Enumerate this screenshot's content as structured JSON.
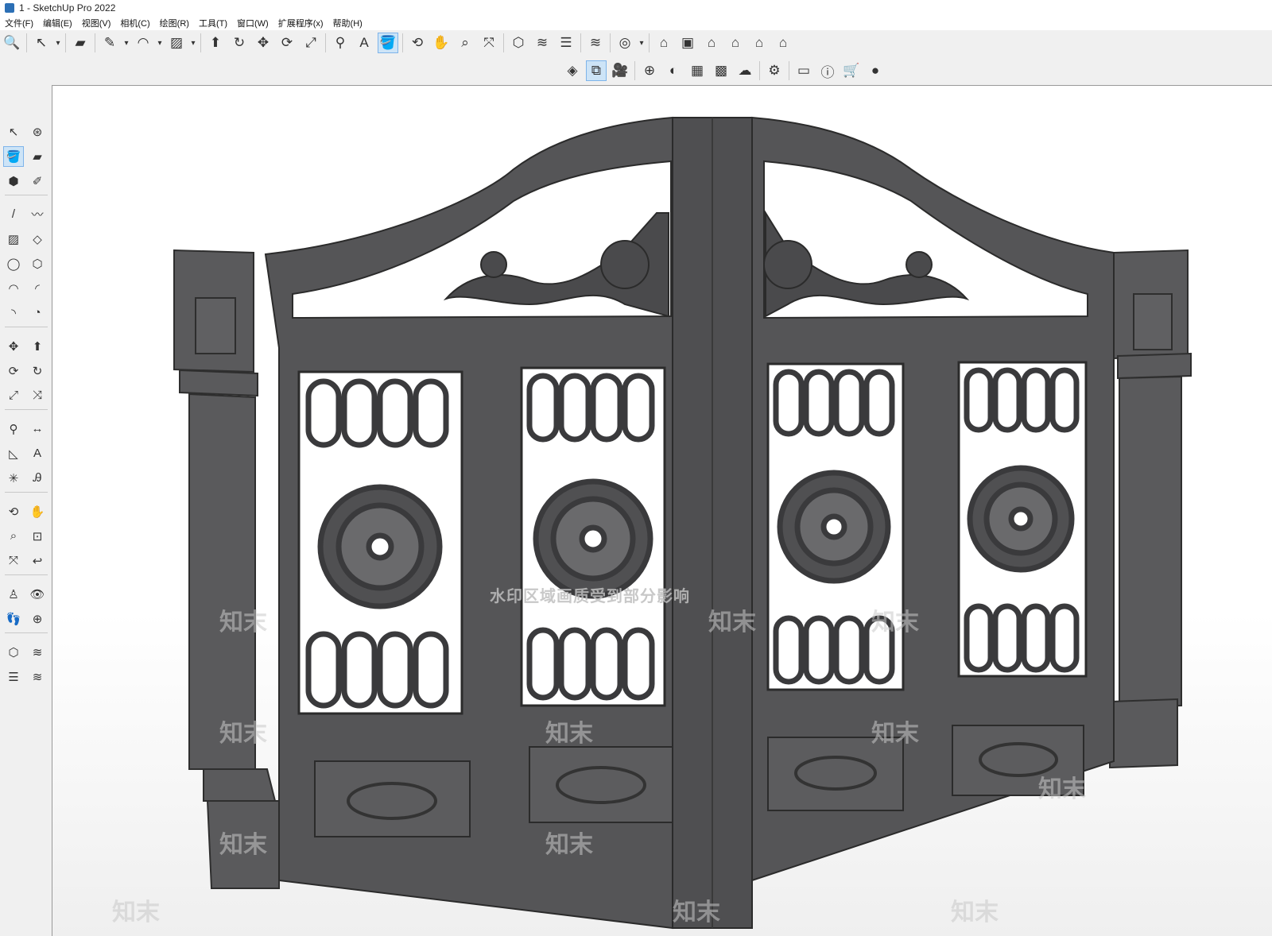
{
  "window": {
    "title": "1 - SketchUp Pro 2022"
  },
  "menu": [
    "文件(F)",
    "编辑(E)",
    "视图(V)",
    "相机(C)",
    "绘图(R)",
    "工具(T)",
    "窗口(W)",
    "扩展程序(x)",
    "帮助(H)"
  ],
  "toolbar_main": [
    {
      "name": "search-icon",
      "glyph": "🔍"
    },
    {
      "name": "sep"
    },
    {
      "name": "select-icon",
      "glyph": "↖"
    },
    {
      "name": "dropdown-icon",
      "glyph": "▾",
      "small": true
    },
    {
      "name": "sep"
    },
    {
      "name": "eraser-icon",
      "glyph": "▰"
    },
    {
      "name": "sep"
    },
    {
      "name": "pencil-icon",
      "glyph": "✎"
    },
    {
      "name": "dropdown-icon",
      "glyph": "▾",
      "small": true
    },
    {
      "name": "arc-icon",
      "glyph": "◠"
    },
    {
      "name": "dropdown-icon",
      "glyph": "▾",
      "small": true
    },
    {
      "name": "rectangle-icon",
      "glyph": "▨"
    },
    {
      "name": "dropdown-icon",
      "glyph": "▾",
      "small": true
    },
    {
      "name": "sep"
    },
    {
      "name": "push-pull-icon",
      "glyph": "⬆"
    },
    {
      "name": "follow-me-icon",
      "glyph": "↻"
    },
    {
      "name": "move-icon",
      "glyph": "✥"
    },
    {
      "name": "rotate-icon",
      "glyph": "⟳"
    },
    {
      "name": "scale-icon",
      "glyph": "⤢"
    },
    {
      "name": "sep"
    },
    {
      "name": "tape-measure-icon",
      "glyph": "⚲"
    },
    {
      "name": "text-icon",
      "glyph": "A"
    },
    {
      "name": "paint-bucket-icon",
      "glyph": "🪣",
      "active": true
    },
    {
      "name": "sep"
    },
    {
      "name": "orbit-icon",
      "glyph": "⟲"
    },
    {
      "name": "pan-icon",
      "glyph": "✋"
    },
    {
      "name": "zoom-icon",
      "glyph": "⌕"
    },
    {
      "name": "zoom-extents-icon",
      "glyph": "⤧"
    },
    {
      "name": "sep"
    },
    {
      "name": "warehouse-icon",
      "glyph": "⬡"
    },
    {
      "name": "extension-warehouse-icon",
      "glyph": "≋"
    },
    {
      "name": "layers-icon",
      "glyph": "☰"
    },
    {
      "name": "sep"
    },
    {
      "name": "extension-manager-icon",
      "glyph": "≋"
    },
    {
      "name": "sep"
    },
    {
      "name": "account-icon",
      "glyph": "◎"
    },
    {
      "name": "dropdown-icon",
      "glyph": "▾",
      "small": true
    },
    {
      "name": "sep"
    },
    {
      "name": "iso-view-icon",
      "glyph": "⌂"
    },
    {
      "name": "top-view-icon",
      "glyph": "▣"
    },
    {
      "name": "front-view-icon",
      "glyph": "⌂"
    },
    {
      "name": "right-view-icon",
      "glyph": "⌂"
    },
    {
      "name": "back-view-icon",
      "glyph": "⌂"
    },
    {
      "name": "left-view-icon",
      "glyph": "⌂"
    }
  ],
  "toolbar_secondary": [
    {
      "name": "solid-tools-icon",
      "glyph": "◈"
    },
    {
      "name": "section-plane-icon",
      "glyph": "⧉",
      "active": true
    },
    {
      "name": "camera-icon",
      "glyph": "🎥"
    },
    {
      "name": "sep"
    },
    {
      "name": "add-icon",
      "glyph": "⊕"
    },
    {
      "name": "shadow-icon",
      "glyph": "◐"
    },
    {
      "name": "styles-icon",
      "glyph": "▦"
    },
    {
      "name": "texture-icon",
      "glyph": "▩"
    },
    {
      "name": "cloud-upload-icon",
      "glyph": "☁"
    },
    {
      "name": "sep"
    },
    {
      "name": "settings-icon",
      "glyph": "⚙"
    },
    {
      "name": "sep"
    },
    {
      "name": "scenes-icon",
      "glyph": "▭"
    },
    {
      "name": "info-icon",
      "glyph": "ⓘ"
    },
    {
      "name": "cart-icon",
      "glyph": "🛒"
    },
    {
      "name": "profile-icon",
      "glyph": "●"
    }
  ],
  "left_tools": [
    [
      {
        "name": "select-tool-icon",
        "glyph": "↖"
      },
      {
        "name": "orbit-tool-icon",
        "glyph": "⊛"
      }
    ],
    [
      {
        "name": "paint-tool-icon",
        "glyph": "🪣",
        "active": true
      },
      {
        "name": "eraser-tool-icon",
        "glyph": "▰"
      }
    ],
    [
      {
        "name": "component-tool-icon",
        "glyph": "⬢"
      },
      {
        "name": "tag-tool-icon",
        "glyph": "✐"
      }
    ],
    "sep",
    [
      {
        "name": "line-tool-icon",
        "glyph": "/"
      },
      {
        "name": "freehand-tool-icon",
        "glyph": "〰"
      }
    ],
    [
      {
        "name": "rectangle-tool-icon",
        "glyph": "▨"
      },
      {
        "name": "rotated-rect-tool-icon",
        "glyph": "◇"
      }
    ],
    [
      {
        "name": "circle-tool-icon",
        "glyph": "◯"
      },
      {
        "name": "polygon-tool-icon",
        "glyph": "⬡"
      }
    ],
    [
      {
        "name": "arc-tool-icon",
        "glyph": "◠"
      },
      {
        "name": "two-point-arc-tool-icon",
        "glyph": "◜"
      }
    ],
    [
      {
        "name": "three-point-arc-tool-icon",
        "glyph": "◝"
      },
      {
        "name": "pie-tool-icon",
        "glyph": "◔"
      }
    ],
    "sep",
    [
      {
        "name": "move-tool-icon",
        "glyph": "✥"
      },
      {
        "name": "push-pull-tool-icon",
        "glyph": "⬆"
      }
    ],
    [
      {
        "name": "rotate-tool-icon",
        "glyph": "⟳"
      },
      {
        "name": "follow-me-tool-icon",
        "glyph": "↻"
      }
    ],
    [
      {
        "name": "scale-tool-icon",
        "glyph": "⤢"
      },
      {
        "name": "offset-tool-icon",
        "glyph": "⤨"
      }
    ],
    "sep",
    [
      {
        "name": "tape-tool-icon",
        "glyph": "⚲"
      },
      {
        "name": "dimension-tool-icon",
        "glyph": "↔"
      }
    ],
    [
      {
        "name": "protractor-tool-icon",
        "glyph": "◺"
      },
      {
        "name": "text-tool-icon",
        "glyph": "A"
      }
    ],
    [
      {
        "name": "axes-tool-icon",
        "glyph": "✳"
      },
      {
        "name": "3d-text-tool-icon",
        "glyph": "Ꭿ"
      }
    ],
    "sep",
    [
      {
        "name": "orbit-nav-icon",
        "glyph": "⟲"
      },
      {
        "name": "pan-nav-icon",
        "glyph": "✋"
      }
    ],
    [
      {
        "name": "zoom-nav-icon",
        "glyph": "⌕"
      },
      {
        "name": "zoom-window-icon",
        "glyph": "⊡"
      }
    ],
    [
      {
        "name": "zoom-extents-nav-icon",
        "glyph": "⤧"
      },
      {
        "name": "previous-view-icon",
        "glyph": "↩"
      }
    ],
    "sep",
    [
      {
        "name": "position-camera-icon",
        "glyph": "♙"
      },
      {
        "name": "look-around-icon",
        "glyph": "👁"
      }
    ],
    [
      {
        "name": "walk-icon",
        "glyph": "👣"
      },
      {
        "name": "section-tool-icon",
        "glyph": "⊕"
      }
    ],
    "sep",
    [
      {
        "name": "warehouse-tool-icon",
        "glyph": "⬡"
      },
      {
        "name": "extension-tool-icon",
        "glyph": "≋"
      }
    ],
    [
      {
        "name": "layers-tool-icon",
        "glyph": "☰"
      },
      {
        "name": "extension-manager-tool-icon",
        "glyph": "≋"
      }
    ]
  ],
  "watermark": {
    "notice": "水印区域画质受到部分影响",
    "brand": "知末"
  }
}
